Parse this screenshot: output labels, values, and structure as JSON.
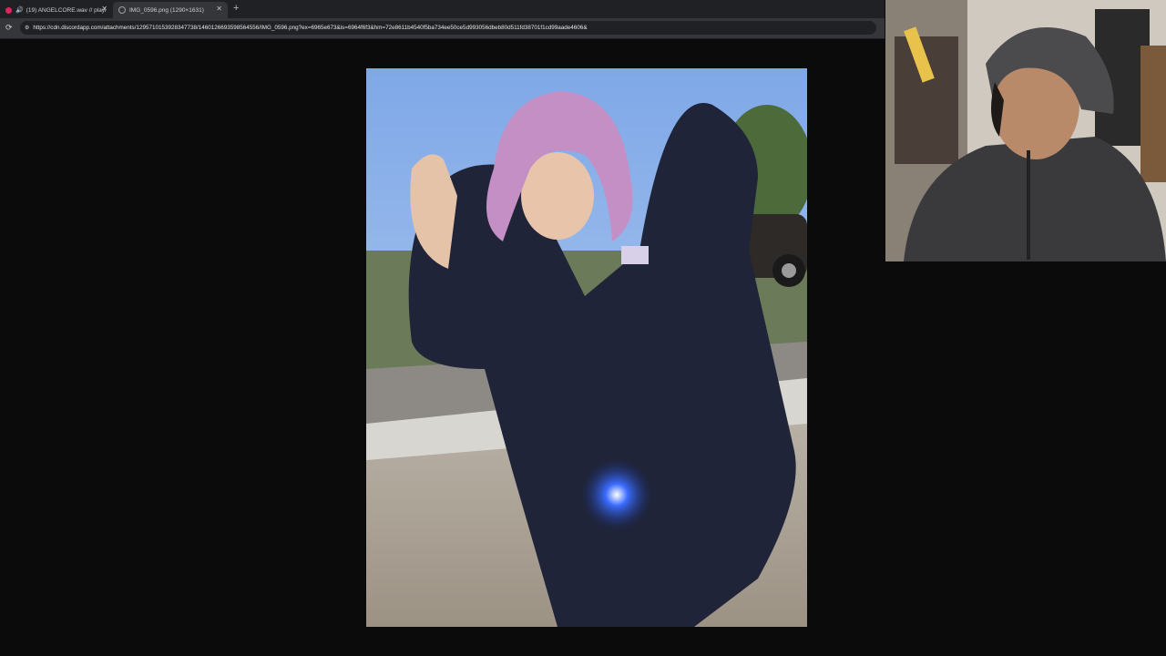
{
  "browser": {
    "tabs": [
      {
        "title": "(19) ANGELCORE.wav // playi",
        "active": false,
        "has_audio": true,
        "favicon_color": "#e0245e"
      },
      {
        "title": "IMG_0596.png (1290×1631)",
        "active": true,
        "has_audio": false,
        "favicon_color": "#9aa0a6"
      }
    ],
    "url": "https://cdn.discordapp.com/attachments/1295710153928347738/1460126693598564556/IMG_0596.png?ex=6965e673&is=6964f6f3&hm=72e8611b4540f5ba734ee50ce5d993056dbeb80d511fd38701f1cd99aade4606&"
  },
  "image_viewer": {
    "image_name": "IMG_0596.png",
    "image_description": "photo"
  },
  "webcam": {
    "label": "webcam overlay"
  },
  "colors": {
    "tab_bar": "#202124",
    "url_bar": "#35363a",
    "page_background": "#0b0b0b"
  }
}
